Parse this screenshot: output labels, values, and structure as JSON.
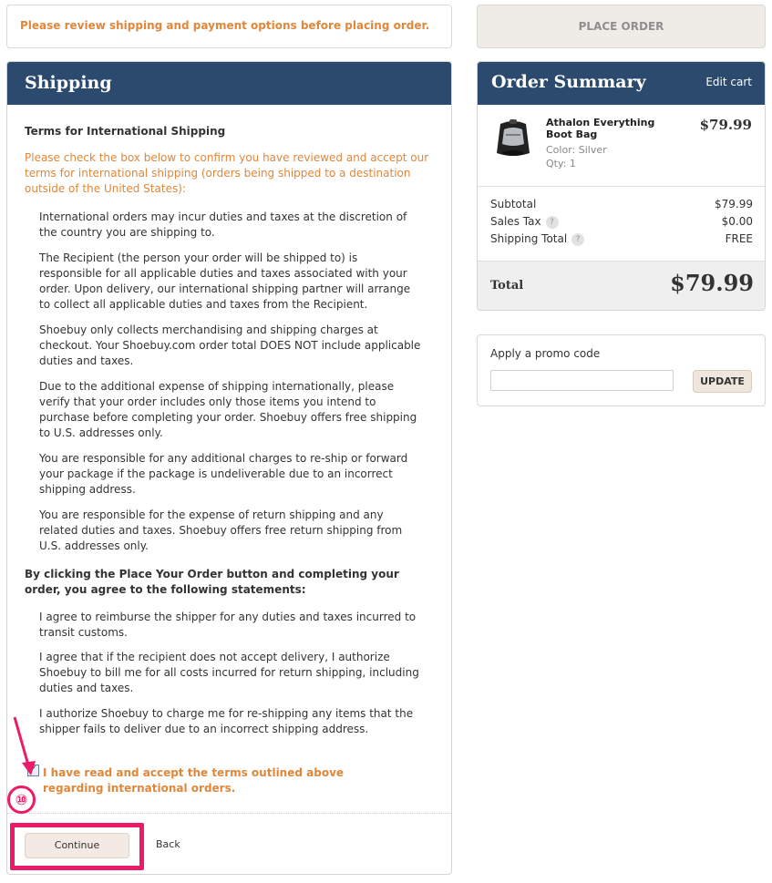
{
  "notice": {
    "text": "Please review shipping and payment options before placing order."
  },
  "place_order": {
    "label": "PLACE ORDER"
  },
  "shipping": {
    "title": "Shipping",
    "terms_title": "Terms for International Shipping",
    "intro": "Please check the box below to confirm you have reviewed and accept our terms for international shipping (orders being shipped to a destination outside of the United States):",
    "paragraphs": [
      "International orders may incur duties and taxes at the discretion of the country you are shipping to.",
      "The Recipient (the person your order will be shipped to) is responsible for all applicable duties and taxes associated with your order. Upon delivery, our international shipping partner will arrange to collect all applicable duties and taxes from the Recipient.",
      "Shoebuy only collects merchandising and shipping charges at checkout. Your Shoebuy.com order total DOES NOT include applicable duties and taxes.",
      "Due to the additional expense of shipping internationally, please verify that your order includes only those items you intend to purchase before completing your order. Shoebuy offers free shipping to U.S. addresses only.",
      "You are responsible for any additional charges to re-ship or forward your package if the package is undeliverable due to an incorrect shipping address.",
      "You are responsible for the expense of return shipping and any related duties and taxes. Shoebuy offers free return shipping from U.S. addresses only."
    ],
    "agree_heading": "By clicking the Place Your Order button and completing your order, you agree to the following statements:",
    "statements": [
      "I agree to reimburse the shipper for any duties and taxes incurred to transit customs.",
      "I agree that if the recipient does not accept delivery, I authorize Shoebuy to bill me for all costs incurred for return shipping, including duties and taxes.",
      "I authorize Shoebuy to charge me for re-shipping any items that the shipper fails to deliver due to an incorrect shipping address."
    ],
    "accept_label": "I have read and accept the terms outlined above regarding international orders.",
    "accept_checked": true,
    "continue_label": "Continue",
    "back_label": "Back"
  },
  "annotation": {
    "step": "⑩",
    "color": "#ec1b68"
  },
  "summary": {
    "title": "Order Summary",
    "edit_cart": "Edit cart",
    "item": {
      "name": "Athalon Everything Boot Bag",
      "color": "Color: Silver",
      "qty": "Qty: 1",
      "price": "$79.99",
      "image_icon": "boot-bag-image"
    },
    "subtotal_label": "Subtotal",
    "subtotal_value": "$79.99",
    "tax_label": "Sales Tax",
    "tax_value": "$0.00",
    "shipping_label": "Shipping Total",
    "shipping_value": "FREE",
    "help_glyph": "?",
    "total_label": "Total",
    "total_value": "$79.99"
  },
  "promo": {
    "label": "Apply a promo code",
    "input_value": "",
    "button_label": "UPDATE"
  },
  "colors": {
    "header_bg": "#2b4a6d",
    "accent_orange": "#e0873a",
    "button_bg": "#efe7de"
  }
}
